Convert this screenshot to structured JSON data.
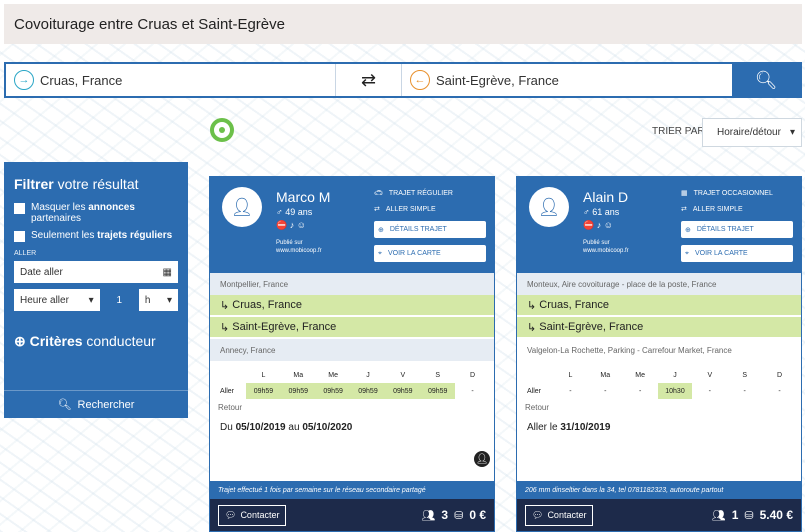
{
  "page_title": "Covoiturage entre Cruas et Saint-Egrève",
  "search": {
    "from": "Cruas, France",
    "to": "Saint-Egrève, France"
  },
  "sort": {
    "label": "TRIER PAR",
    "value": "Horaire/détour"
  },
  "filter": {
    "title_bold": "Filtrer",
    "title_rest": " votre résultat",
    "opt1_a": "Masquer les ",
    "opt1_b": "annonces",
    "opt1_c": " partenaires",
    "opt2_a": "Seulement les ",
    "opt2_b": "trajets réguliers",
    "aller_label": "ALLER",
    "date_placeholder": "Date aller",
    "heure": "Heure aller",
    "heure_num": "1",
    "heure_unit": "h",
    "crit_bold": "Critères",
    "crit_rest": " conducteur",
    "search_btn": "Rechercher"
  },
  "cards": [
    {
      "name": "Marco M",
      "age": "49 ans",
      "pub1": "Publié sur",
      "pub2": "www.mobicoop.fr",
      "type": "TRAJET RÉGULIER",
      "mode": "ALLER SIMPLE",
      "btn_detail": "DÉTAILS TRAJET",
      "btn_map": "VOIR LA CARTE",
      "origin": "Montpellier, France",
      "stop1": "Cruas, France",
      "stop2": "Saint-Egrève, France",
      "dest": "Annecy, France",
      "days": [
        "L",
        "Ma",
        "Me",
        "J",
        "V",
        "S",
        "D"
      ],
      "aller_label": "Aller",
      "aller": [
        "09h59",
        "09h59",
        "09h59",
        "09h59",
        "09h59",
        "09h59",
        "-"
      ],
      "retour_label": "Retour",
      "dates_pre": "Du ",
      "date1": "05/10/2019",
      "dates_mid": " au ",
      "date2": "05/10/2020",
      "note": "Trajet effectué 1 fois par semaine sur le réseau secondaire partagé",
      "contact": "Contacter",
      "seats": "3",
      "price": "0 €"
    },
    {
      "name": "Alain D",
      "age": "61 ans",
      "pub1": "Publié sur",
      "pub2": "www.mobicoop.fr",
      "type": "TRAJET OCCASIONNEL",
      "mode": "ALLER SIMPLE",
      "btn_detail": "DÉTAILS TRAJET",
      "btn_map": "VOIR LA CARTE",
      "origin": "Monteux, Aire covoiturage - place de la poste, France",
      "stop1": "Cruas, France",
      "stop2": "Saint-Egrève, France",
      "dest": "Valgelon-La Rochette, Parking - Carrefour Market, France",
      "days": [
        "L",
        "Ma",
        "Me",
        "J",
        "V",
        "S",
        "D"
      ],
      "aller_label": "Aller",
      "aller": [
        "-",
        "-",
        "-",
        "10h30",
        "-",
        "-",
        "-"
      ],
      "retour_label": "Retour",
      "dates_pre": "Aller le ",
      "date1": "31/10/2019",
      "dates_mid": "",
      "date2": "",
      "note": "206 mm dinseltier dans la 34, tel 0781182323, autoroute partout",
      "contact": "Contacter",
      "seats": "1",
      "price": "5.40 €"
    }
  ]
}
